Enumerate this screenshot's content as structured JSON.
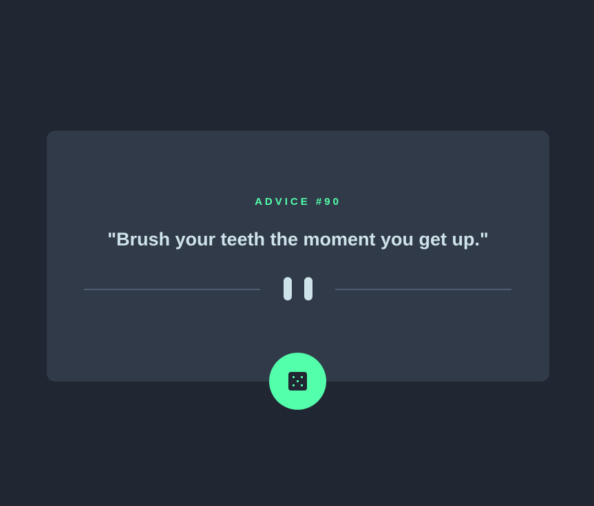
{
  "advice": {
    "id_label": "ADVICE #90",
    "quote": "\"Brush your teeth the moment you get up.\""
  },
  "divider": {
    "icon": "pause-icon"
  },
  "dice_button": {
    "icon": "dice-icon"
  },
  "colors": {
    "background": "#202632",
    "card": "#313a49",
    "accent": "#53ffaa",
    "text": "#cee3e9",
    "divider_line": "#4f5d74"
  }
}
